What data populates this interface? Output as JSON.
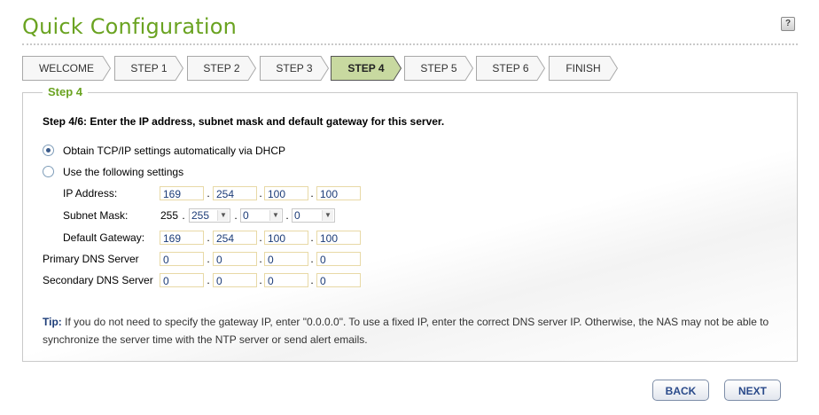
{
  "header": {
    "title": "Quick Configuration",
    "help_label": "?"
  },
  "steps": [
    "WELCOME",
    "STEP 1",
    "STEP 2",
    "STEP 3",
    "STEP 4",
    "STEP 5",
    "STEP 6",
    "FINISH"
  ],
  "active_step_index": 4,
  "panel": {
    "legend": "Step 4",
    "heading": "Step 4/6: Enter the IP address, subnet mask and default gateway for this server.",
    "option_dhcp": "Obtain TCP/IP settings automatically via DHCP",
    "option_manual": "Use the following settings",
    "selected_option": "dhcp",
    "ip_address": {
      "label": "IP Address:",
      "octets": [
        "169",
        "254",
        "100",
        "100"
      ]
    },
    "subnet_mask": {
      "label": "Subnet Mask:",
      "first": "255",
      "octets": [
        "255",
        "0",
        "0"
      ]
    },
    "default_gateway": {
      "label": "Default Gateway:",
      "octets": [
        "169",
        "254",
        "100",
        "100"
      ]
    },
    "primary_dns": {
      "label": "Primary DNS Server",
      "octets": [
        "0",
        "0",
        "0",
        "0"
      ]
    },
    "secondary_dns": {
      "label": "Secondary DNS Server",
      "octets": [
        "0",
        "0",
        "0",
        "0"
      ]
    },
    "dot": ".",
    "tip_label": "Tip:",
    "tip_text": "If you do not need to specify the gateway IP, enter \"0.0.0.0\". To use a fixed IP, enter the correct DNS server IP. Otherwise, the NAS may not be able to synchronize the server time with the NTP server or send alert emails."
  },
  "buttons": {
    "back": "BACK",
    "next": "NEXT"
  },
  "colors": {
    "accent": "#6aa321",
    "active_step_bg": "#c8d9a0",
    "link": "#1c3c78"
  }
}
